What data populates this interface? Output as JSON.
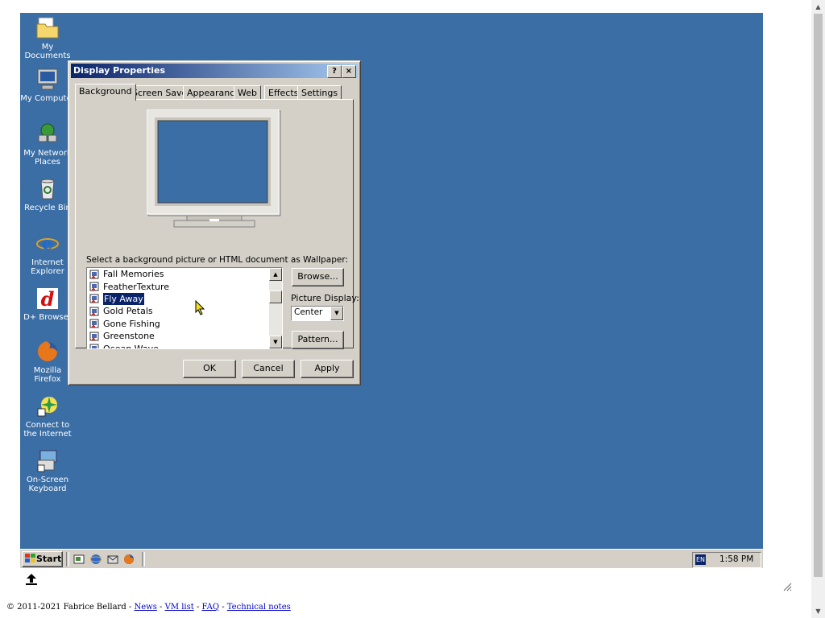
{
  "desktop": {
    "icons": [
      {
        "label": "My Documents",
        "icon": "folder-documents-icon"
      },
      {
        "label": "My Computer",
        "icon": "computer-icon"
      },
      {
        "label": "My Network Places",
        "icon": "network-icon"
      },
      {
        "label": "Recycle Bin",
        "icon": "recycle-bin-icon"
      },
      {
        "label": "Internet Explorer",
        "icon": "ie-icon"
      },
      {
        "label": "D+ Browser",
        "icon": "d-browser-icon"
      },
      {
        "label": "Mozilla Firefox",
        "icon": "firefox-icon"
      },
      {
        "label": "Connect to the Internet",
        "icon": "connect-icon"
      },
      {
        "label": "On-Screen Keyboard",
        "icon": "keyboard-icon"
      }
    ]
  },
  "dialog": {
    "title": "Display Properties",
    "help_button": "?",
    "close_button": "×",
    "tabs": [
      "Background",
      "Screen Saver",
      "Appearance",
      "Web",
      "Effects",
      "Settings"
    ],
    "active_tab": "Background",
    "wallpaper_label": "Select a background picture or HTML document as Wallpaper:",
    "wallpapers": [
      {
        "name": "Fall Memories",
        "selected": false
      },
      {
        "name": "FeatherTexture",
        "selected": false
      },
      {
        "name": "Fly Away",
        "selected": true
      },
      {
        "name": "Gold Petals",
        "selected": false
      },
      {
        "name": "Gone Fishing",
        "selected": false
      },
      {
        "name": "Greenstone",
        "selected": false
      },
      {
        "name": "Ocean Wave",
        "selected": false
      }
    ],
    "browse_button": "Browse...",
    "picture_display_label": "Picture Display:",
    "picture_display_value": "Center",
    "pattern_button": "Pattern...",
    "ok_button": "OK",
    "cancel_button": "Cancel",
    "apply_button": "Apply"
  },
  "taskbar": {
    "start_label": "Start",
    "quick_launch": [
      "show-desktop-icon",
      "ie-quicklaunch-icon",
      "outlook-quicklaunch-icon",
      "firefox-quicklaunch-icon"
    ],
    "language": "EN",
    "clock": "1:58 PM"
  },
  "footer": {
    "copyright": "© 2011-2021 Fabrice Bellard - ",
    "links": [
      "News",
      "VM list",
      "FAQ",
      "Technical notes"
    ]
  },
  "colors": {
    "desktop": "#3a6ea5",
    "title_start": "#0a246a",
    "title_end": "#a6caf0",
    "face": "#d4d0c8",
    "selection": "#0a246a"
  }
}
